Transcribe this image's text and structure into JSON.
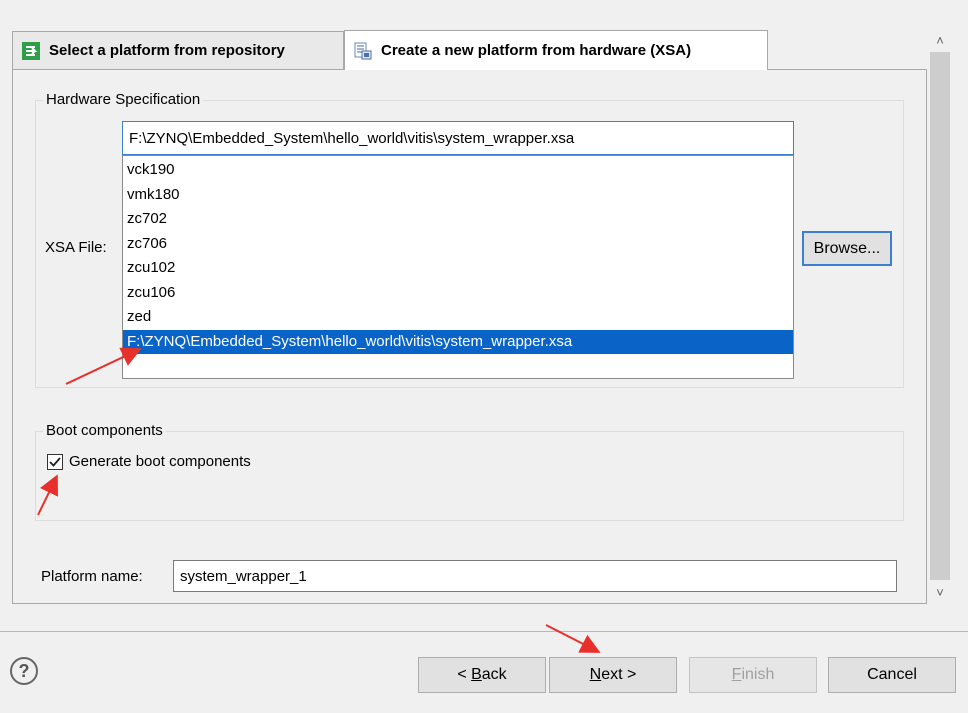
{
  "tabs": [
    {
      "label": "Select a platform from repository",
      "icon": "repository-icon",
      "active": false
    },
    {
      "label": "Create a new platform from hardware (XSA)",
      "icon": "hardware-xsa-icon",
      "active": true
    }
  ],
  "hardware_spec": {
    "group_title": "Hardware Specification",
    "xsa_label": "XSA File:",
    "xsa_value": "F:\\ZYNQ\\Embedded_System\\hello_world\\vitis\\system_wrapper.xsa",
    "dropdown_options": [
      "vck190",
      "vmk180",
      "zc702",
      "zc706",
      "zcu102",
      "zcu106",
      "zed",
      "F:\\ZYNQ\\Embedded_System\\hello_world\\vitis\\system_wrapper.xsa"
    ],
    "selected_option": "F:\\ZYNQ\\Embedded_System\\hello_world\\vitis\\system_wrapper.xsa",
    "browse_label": "Browse..."
  },
  "boot": {
    "group_title": "Boot components",
    "checkbox_label": "Generate boot components",
    "checked": true
  },
  "platform": {
    "label": "Platform name:",
    "value": "system_wrapper_1"
  },
  "footer": {
    "help_icon": "help-icon",
    "back_label": "< Back",
    "next_label": "Next >",
    "finish_label": "Finish",
    "cancel_label": "Cancel",
    "finish_enabled": false
  },
  "colors": {
    "selection": "#0a64c8",
    "annotation_arrow": "#e8302a",
    "focus_border": "#3c7fd1",
    "repository_icon_green": "#2e9e4a"
  }
}
